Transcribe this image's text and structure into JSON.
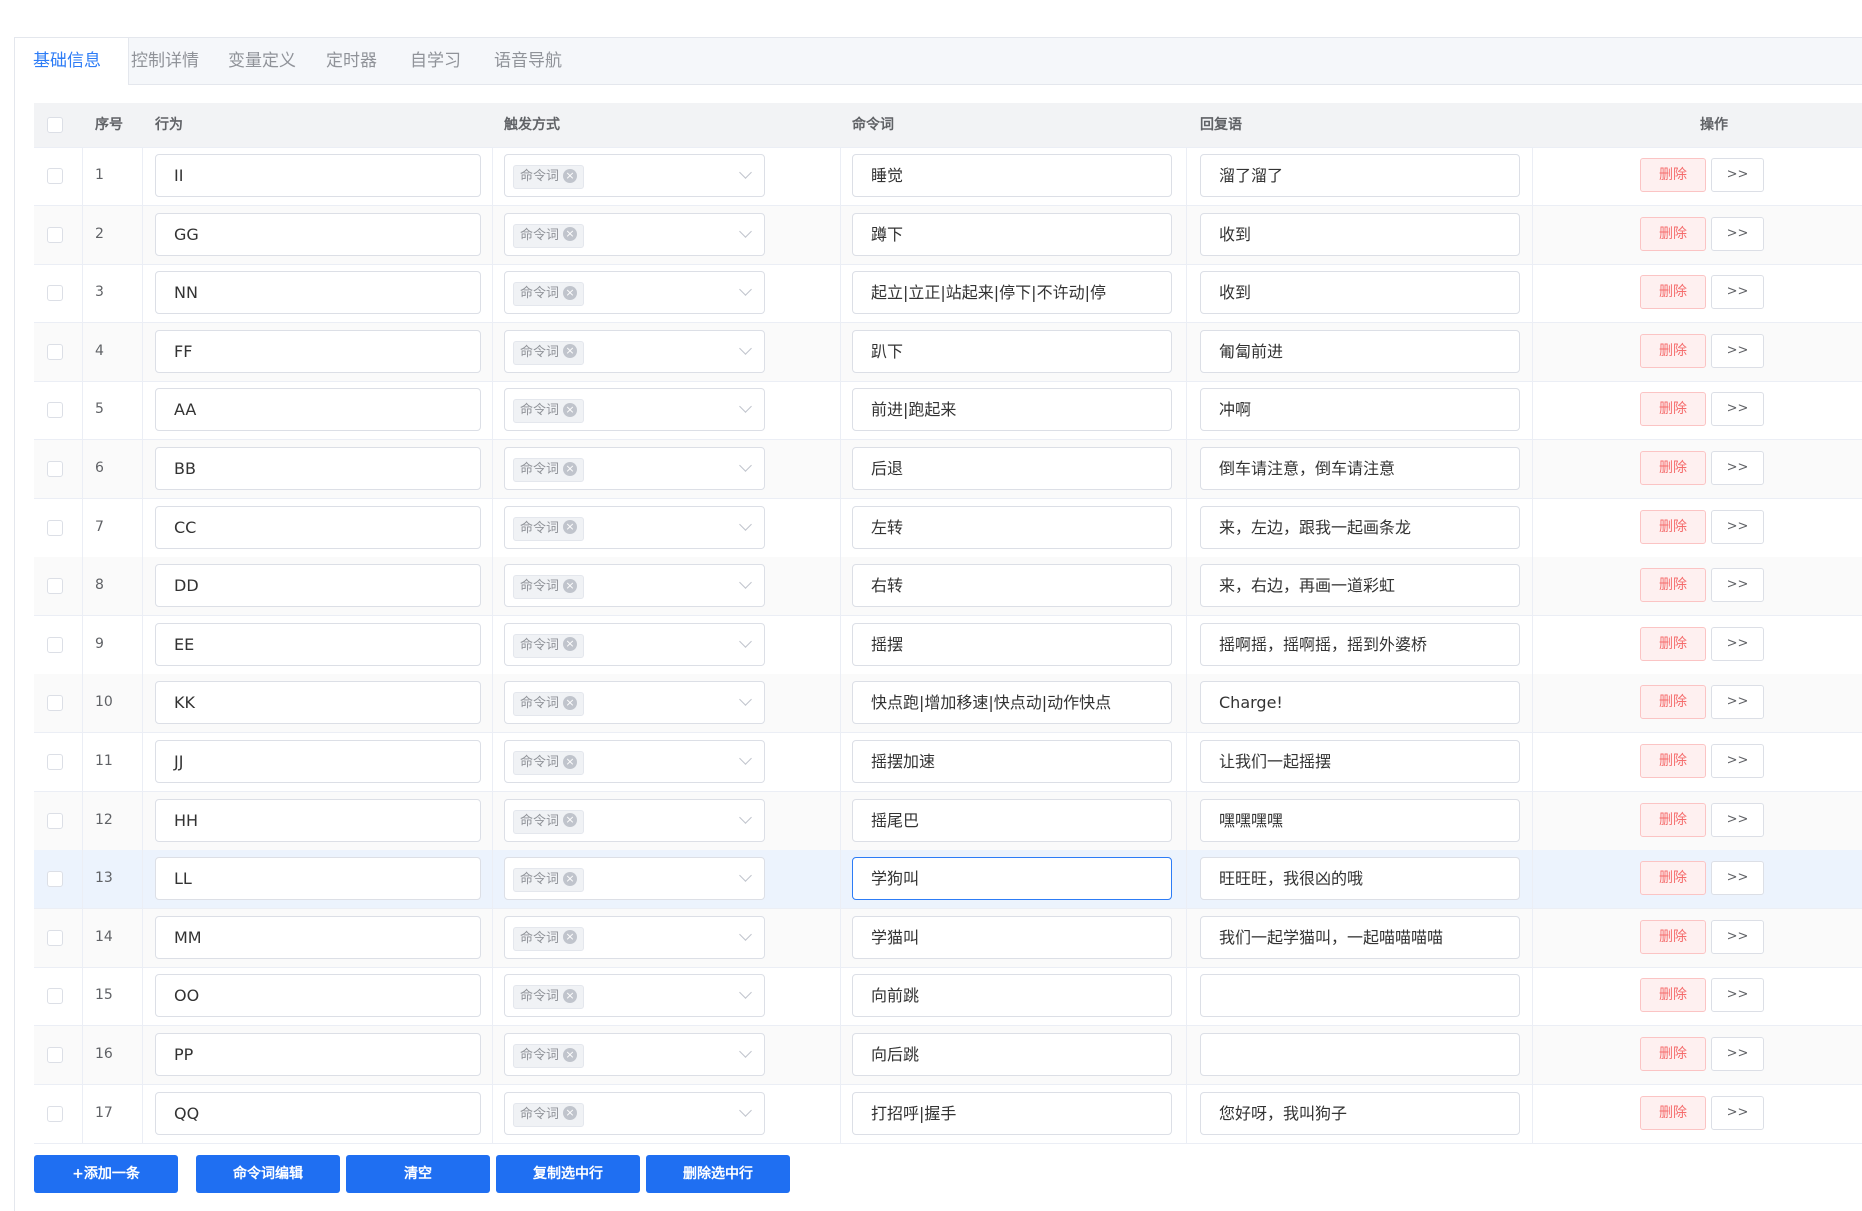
{
  "tabs": [
    "基础信息",
    "控制详情",
    "变量定义",
    "定时器",
    "自学习",
    "语音导航"
  ],
  "table": {
    "headers": {
      "index": "序号",
      "behavior": "行为",
      "trigger": "触发方式",
      "command": "命令词",
      "reply": "回复语",
      "actions": "操作"
    },
    "trigger_tag": "命令词",
    "delete_label": "删除",
    "more_label": ">>",
    "rows": [
      {
        "index": "1",
        "behavior": "II",
        "command": "睡觉",
        "reply": "溜了溜了"
      },
      {
        "index": "2",
        "behavior": "GG",
        "command": "蹲下",
        "reply": "收到"
      },
      {
        "index": "3",
        "behavior": "NN",
        "command": "起立|立正|站起来|停下|不许动|停",
        "reply": "收到"
      },
      {
        "index": "4",
        "behavior": "FF",
        "command": "趴下",
        "reply": "匍匐前进"
      },
      {
        "index": "5",
        "behavior": "AA",
        "command": "前进|跑起来",
        "reply": "冲啊"
      },
      {
        "index": "6",
        "behavior": "BB",
        "command": "后退",
        "reply": "倒车请注意，倒车请注意"
      },
      {
        "index": "7",
        "behavior": "CC",
        "command": "左转",
        "reply": "来，左边，跟我一起画条龙"
      },
      {
        "index": "8",
        "behavior": "DD",
        "command": "右转",
        "reply": "来，右边，再画一道彩虹"
      },
      {
        "index": "9",
        "behavior": "EE",
        "command": "摇摆",
        "reply": "摇啊摇，摇啊摇，摇到外婆桥"
      },
      {
        "index": "10",
        "behavior": "KK",
        "command": "快点跑|增加移速|快点动|动作快点",
        "reply": "Charge!"
      },
      {
        "index": "11",
        "behavior": "JJ",
        "command": "摇摆加速",
        "reply": "让我们一起摇摆"
      },
      {
        "index": "12",
        "behavior": "HH",
        "command": "摇尾巴",
        "reply": "嘿嘿嘿嘿"
      },
      {
        "index": "13",
        "behavior": "LL",
        "command": "学狗叫",
        "reply": "旺旺旺，我很凶的哦"
      },
      {
        "index": "14",
        "behavior": "MM",
        "command": "学猫叫",
        "reply": "我们一起学猫叫，一起喵喵喵喵"
      },
      {
        "index": "15",
        "behavior": "OO",
        "command": "向前跳",
        "reply": ""
      },
      {
        "index": "16",
        "behavior": "PP",
        "command": "向后跳",
        "reply": ""
      },
      {
        "index": "17",
        "behavior": "QQ",
        "command": "打招呼|握手",
        "reply": "您好呀，我叫狗子"
      }
    ]
  },
  "footer_buttons": [
    "+添加一条",
    "命令词编辑",
    "清空",
    "复制选中行",
    "删除选中行"
  ],
  "colors": {
    "accent": "#1f6ff2",
    "danger": "#f56c6c",
    "selected_row": "#ecf3fd"
  }
}
